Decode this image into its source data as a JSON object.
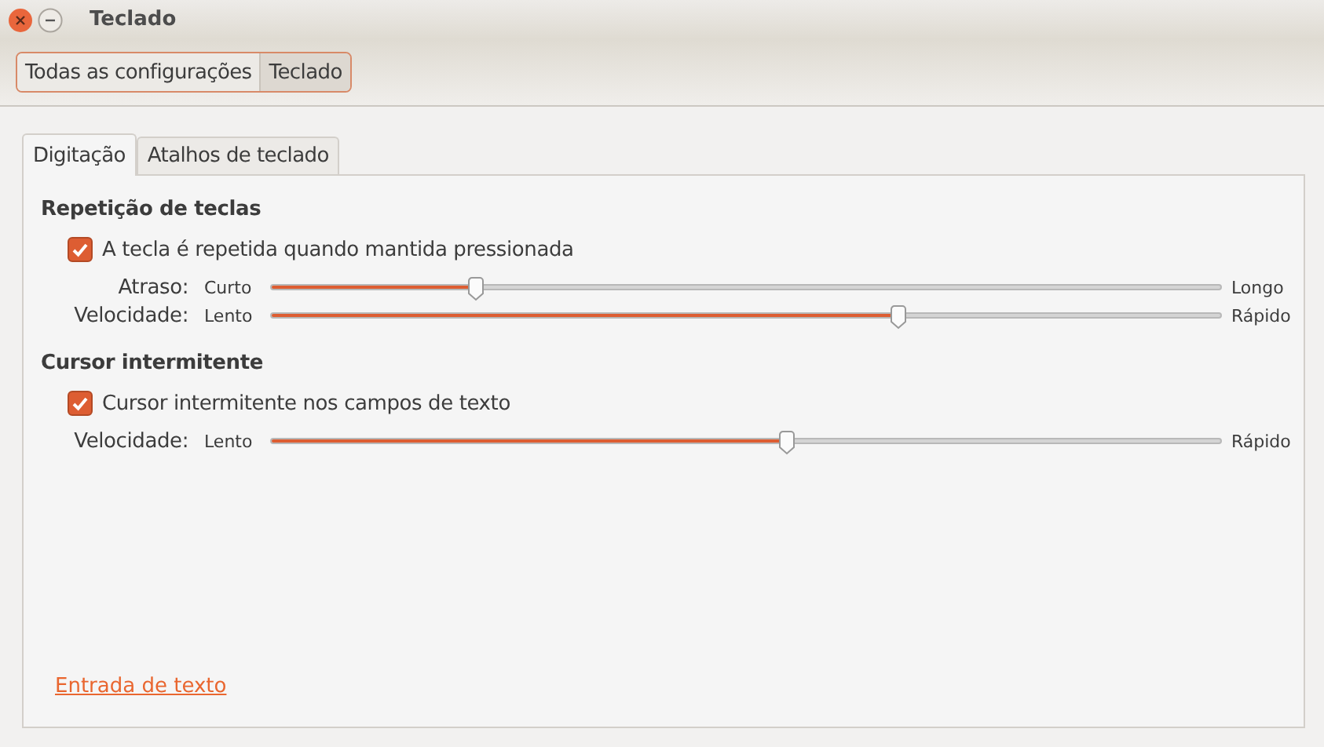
{
  "window": {
    "title": "Teclado"
  },
  "breadcrumb": [
    {
      "label": "Todas as configurações",
      "selected": false
    },
    {
      "label": "Teclado",
      "selected": true
    }
  ],
  "tabs": [
    {
      "label": "Digitação",
      "selected": true
    },
    {
      "label": "Atalhos de teclado",
      "selected": false
    }
  ],
  "sections": [
    {
      "title": "Repetição de teclas",
      "checkbox": {
        "label": "A tecla é repetida quando mantida pressionada",
        "checked": true
      },
      "sliders": [
        {
          "label": "Atraso:",
          "min_label": "Curto",
          "max_label": "Longo",
          "level": 0.216
        },
        {
          "label": "Velocidade:",
          "min_label": "Lento",
          "max_label": "Rápido",
          "level": 0.66
        }
      ]
    },
    {
      "title": "Cursor intermitente",
      "checkbox": {
        "label": "Cursor intermitente nos campos de texto",
        "checked": true
      },
      "sliders": [
        {
          "label": "Velocidade:",
          "min_label": "Lento",
          "max_label": "Rápido",
          "level": 0.543
        }
      ]
    }
  ],
  "link": "Entrada de texto"
}
